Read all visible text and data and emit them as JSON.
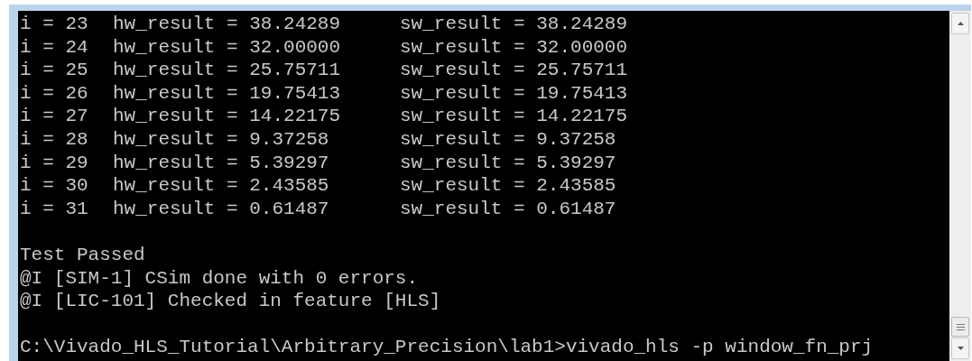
{
  "console": {
    "rows": [
      {
        "index": "i = 23",
        "hw": "hw_result = 38.24289",
        "sw": "sw_result = 38.24289"
      },
      {
        "index": "i = 24",
        "hw": "hw_result = 32.00000",
        "sw": "sw_result = 32.00000"
      },
      {
        "index": "i = 25",
        "hw": "hw_result = 25.75711",
        "sw": "sw_result = 25.75711"
      },
      {
        "index": "i = 26",
        "hw": "hw_result = 19.75413",
        "sw": "sw_result = 19.75413"
      },
      {
        "index": "i = 27",
        "hw": "hw_result = 14.22175",
        "sw": "sw_result = 14.22175"
      },
      {
        "index": "i = 28",
        "hw": "hw_result = 9.37258",
        "sw": "sw_result = 9.37258"
      },
      {
        "index": "i = 29",
        "hw": "hw_result = 5.39297",
        "sw": "sw_result = 5.39297"
      },
      {
        "index": "i = 30",
        "hw": "hw_result = 2.43585",
        "sw": "sw_result = 2.43585"
      },
      {
        "index": "i = 31",
        "hw": "hw_result = 0.61487",
        "sw": "sw_result = 0.61487"
      }
    ],
    "messages": [
      "Test Passed",
      "@I [SIM-1] CSim done with 0 errors.",
      "@I [LIC-101] Checked in feature [HLS]"
    ],
    "prompt": "C:\\Vivado_HLS_Tutorial\\Arbitrary_Precision\\lab1>vivado_hls -p window_fn_prj"
  }
}
